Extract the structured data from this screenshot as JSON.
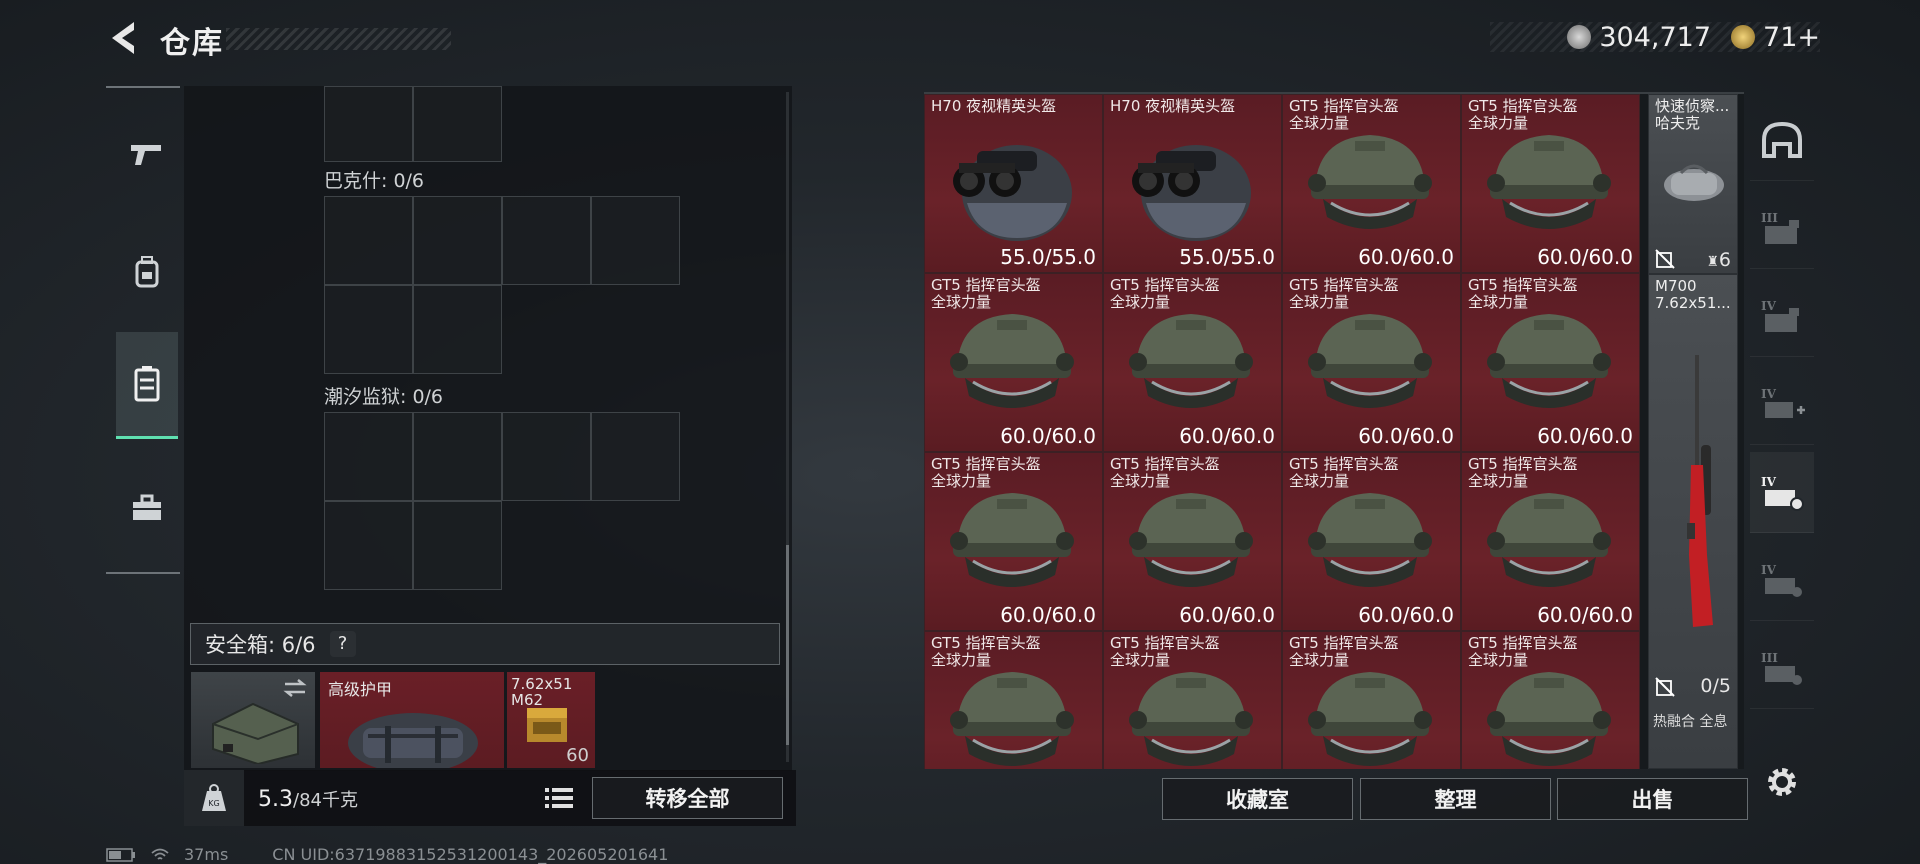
{
  "header": {
    "title": "仓库",
    "silver_amount": "304,717",
    "gold_amount": "71+"
  },
  "left_rail": [
    {
      "name": "weapons",
      "icon": "pistol-icon",
      "active": false
    },
    {
      "name": "backpack",
      "icon": "backpack-icon",
      "active": false
    },
    {
      "name": "container",
      "icon": "container-icon",
      "active": true
    },
    {
      "name": "toolbox",
      "icon": "toolbox-icon",
      "active": false
    }
  ],
  "storage": {
    "sections": [
      {
        "label": "巴克什: 0/6"
      },
      {
        "label": "潮汐监狱: 0/6"
      }
    ],
    "safe_box": {
      "label": "安全箱: 6/6",
      "help": "?"
    },
    "safe_items": [
      {
        "name": "",
        "icon": "case-icon"
      },
      {
        "name": "高级护甲",
        "icon": "armor-icon"
      },
      {
        "name": "7.62x51\nM62",
        "count": "60",
        "icon": "ammo-box-icon"
      }
    ],
    "weight_value": "5.3",
    "weight_max": "/84千克",
    "transfer_all": "转移全部"
  },
  "grid": {
    "rows": [
      [
        {
          "name": "H70 夜视精英头盔",
          "sub": "",
          "durability": "55.0/55.0",
          "type": "nv"
        },
        {
          "name": "H70 夜视精英头盔",
          "sub": "",
          "durability": "55.0/55.0",
          "type": "nv"
        },
        {
          "name": "GT5 指挥官头盔",
          "sub": "全球力量",
          "durability": "60.0/60.0",
          "type": "gt5"
        },
        {
          "name": "GT5 指挥官头盔",
          "sub": "全球力量",
          "durability": "60.0/60.0",
          "type": "gt5"
        }
      ],
      [
        {
          "name": "GT5 指挥官头盔",
          "sub": "全球力量",
          "durability": "60.0/60.0",
          "type": "gt5"
        },
        {
          "name": "GT5 指挥官头盔",
          "sub": "全球力量",
          "durability": "60.0/60.0",
          "type": "gt5"
        },
        {
          "name": "GT5 指挥官头盔",
          "sub": "全球力量",
          "durability": "60.0/60.0",
          "type": "gt5"
        },
        {
          "name": "GT5 指挥官头盔",
          "sub": "全球力量",
          "durability": "60.0/60.0",
          "type": "gt5"
        }
      ],
      [
        {
          "name": "GT5 指挥官头盔",
          "sub": "全球力量",
          "durability": "60.0/60.0",
          "type": "gt5"
        },
        {
          "name": "GT5 指挥官头盔",
          "sub": "全球力量",
          "durability": "60.0/60.0",
          "type": "gt5"
        },
        {
          "name": "GT5 指挥官头盔",
          "sub": "全球力量",
          "durability": "60.0/60.0",
          "type": "gt5"
        },
        {
          "name": "GT5 指挥官头盔",
          "sub": "全球力量",
          "durability": "60.0/60.0",
          "type": "gt5"
        }
      ],
      [
        {
          "name": "GT5 指挥官头盔",
          "sub": "全球力量",
          "durability": "",
          "type": "gt5"
        },
        {
          "name": "GT5 指挥官头盔",
          "sub": "全球力量",
          "durability": "",
          "type": "gt5"
        },
        {
          "name": "GT5 指挥官头盔",
          "sub": "全球力量",
          "durability": "",
          "type": "gt5"
        },
        {
          "name": "GT5 指挥官头盔",
          "sub": "全球力量",
          "durability": "",
          "type": "gt5"
        }
      ]
    ],
    "side_items": {
      "bag": {
        "name": "快速侦察...",
        "sub": "哈夫克",
        "count": "6"
      },
      "rifle": {
        "name": "M700",
        "sub": "7.62x51...",
        "count": "0/5",
        "footer": "热融合 全息"
      }
    },
    "buttons": {
      "collection": "收藏室",
      "sort": "整理",
      "sell": "出售"
    }
  },
  "right_rail": [
    "helmet-slot-icon",
    "tier3-case-icon",
    "tier4-case-icon",
    "tier4-add-icon",
    "tier4-lock-icon",
    "tier4-case-2-icon",
    "tier3-case-2-icon"
  ],
  "status": {
    "ping": "37ms",
    "uid": "CN UID:63719883152531200143_202605201641"
  },
  "colors": {
    "accent": "#5fe0b0",
    "item_red": "#6a2229"
  }
}
